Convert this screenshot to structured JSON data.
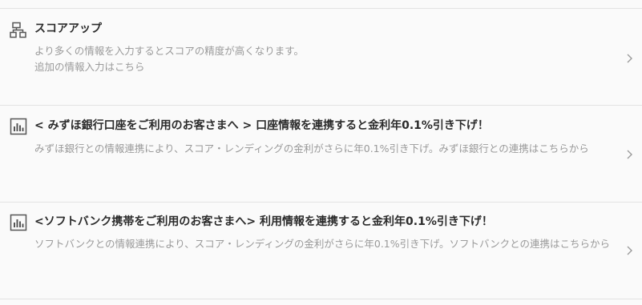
{
  "items": [
    {
      "icon": "flowchart-icon",
      "title": "スコアアップ",
      "description_lines": [
        "より多くの情報を入力するとスコアの精度が高くなります。",
        "追加の情報入力はこちら"
      ]
    },
    {
      "icon": "bar-chart-icon",
      "title": "< みずほ銀行口座をご利用のお客さまへ > 口座情報を連携すると金利年0.1%引き下げ！",
      "description": "みずほ銀行との情報連携により、スコア・レンディングの金利がさらに年0.1%引き下げ。みずほ銀行との連携はこちらから"
    },
    {
      "icon": "bar-chart-icon",
      "title": "<ソフトバンク携帯をご利用のお客さまへ> 利用情報を連携すると金利年0.1%引き下げ！",
      "description": "ソフトバンクとの情報連携により、スコア・レンディングの金利がさらに年0.1%引き下げ。ソフトバンクとの連携はこちらから"
    }
  ],
  "colors": {
    "background": "#fafafa",
    "divider": "#e3e3e3",
    "title": "#2b2b2b",
    "description": "#9a9a9a",
    "icon": "#555555",
    "chevron": "#9a9a9a"
  }
}
